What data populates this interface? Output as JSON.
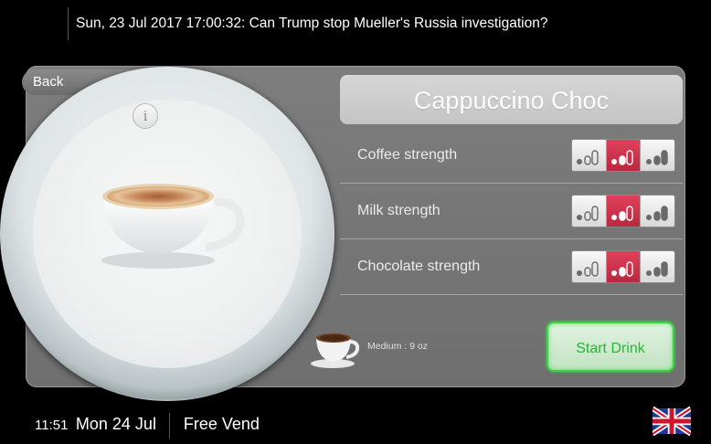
{
  "ticker": {
    "text": "Sun, 23 Jul 2017 17:00:32: Can Trump stop Mueller's Russia investigation?"
  },
  "nav": {
    "back_label": "Back"
  },
  "drink": {
    "title": "Cappuccino Choc",
    "info_icon": "info-icon",
    "image_icon": "cappuccino-cup-icon"
  },
  "settings": [
    {
      "label": "Coffee strength",
      "selected_level": 2,
      "levels": 3
    },
    {
      "label": "Milk strength",
      "selected_level": 2,
      "levels": 3
    },
    {
      "label": "Chocolate strength",
      "selected_level": 2,
      "levels": 3
    }
  ],
  "size": {
    "label": "Medium : 9 oz",
    "icon": "coffee-cup-icon"
  },
  "actions": {
    "start_label": "Start Drink"
  },
  "status": {
    "time": "11:51",
    "date": "Mon 24 Jul",
    "mode": "Free Vend"
  },
  "language": {
    "icon": "uk-flag-icon"
  },
  "colors": {
    "selected": "#c8304a",
    "start_border": "#3fd04a",
    "panel": "#767676"
  }
}
